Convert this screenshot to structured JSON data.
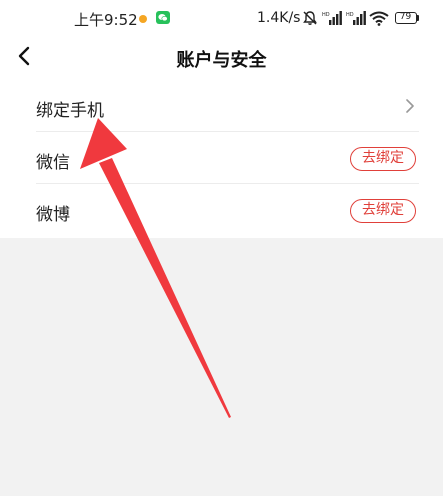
{
  "status_bar": {
    "time": "上午9:52",
    "network_speed": "1.4K/s",
    "battery_level": "79",
    "dot_color": "#f5a623",
    "wechat_color": "#27c15b"
  },
  "header": {
    "title": "账户与安全",
    "back_icon": "chevron-left-icon"
  },
  "accounts": {
    "items": [
      {
        "label": "绑定手机",
        "icon": "chevron-right-icon"
      },
      {
        "label": "微信",
        "action_label": "去绑定"
      },
      {
        "label": "微博",
        "action_label": "去绑定"
      }
    ]
  },
  "colors": {
    "accent": "#e0403a",
    "annotation_arrow": "#f0393e",
    "page_background": "#f2f2f2"
  }
}
